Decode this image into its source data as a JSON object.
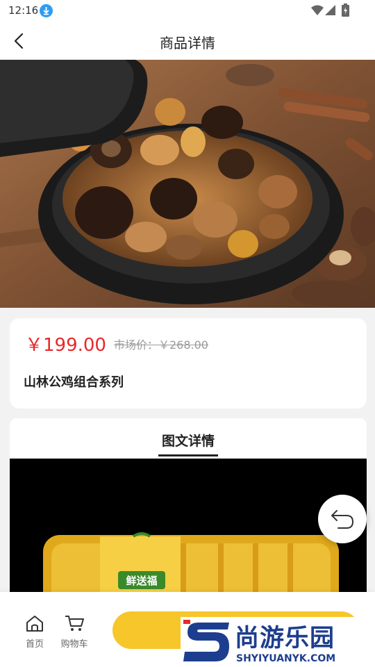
{
  "status_bar": {
    "time": "12:16"
  },
  "nav": {
    "title": "商品详情"
  },
  "product": {
    "price": "￥199.00",
    "market_price": "市场价：￥268.00",
    "name": "山林公鸡组合系列"
  },
  "detail": {
    "tab_label": "图文详情",
    "package_brand": "鲜送福"
  },
  "bottom_bar": {
    "home_label": "首页",
    "cart_label": "购物车"
  },
  "watermark": {
    "text": "尚游乐园",
    "url": "SHYIYUANYK.COM"
  },
  "colors": {
    "price_red": "#e8282b",
    "buy_yellow": "#f6c62a",
    "watermark_blue": "#1d3e8f"
  },
  "icons": [
    "download-icon",
    "wifi-icon",
    "signal-icon",
    "battery-icon",
    "back-icon",
    "home-icon",
    "cart-icon",
    "return-icon"
  ],
  "carousel": {
    "current_index": 1,
    "total": 1
  }
}
